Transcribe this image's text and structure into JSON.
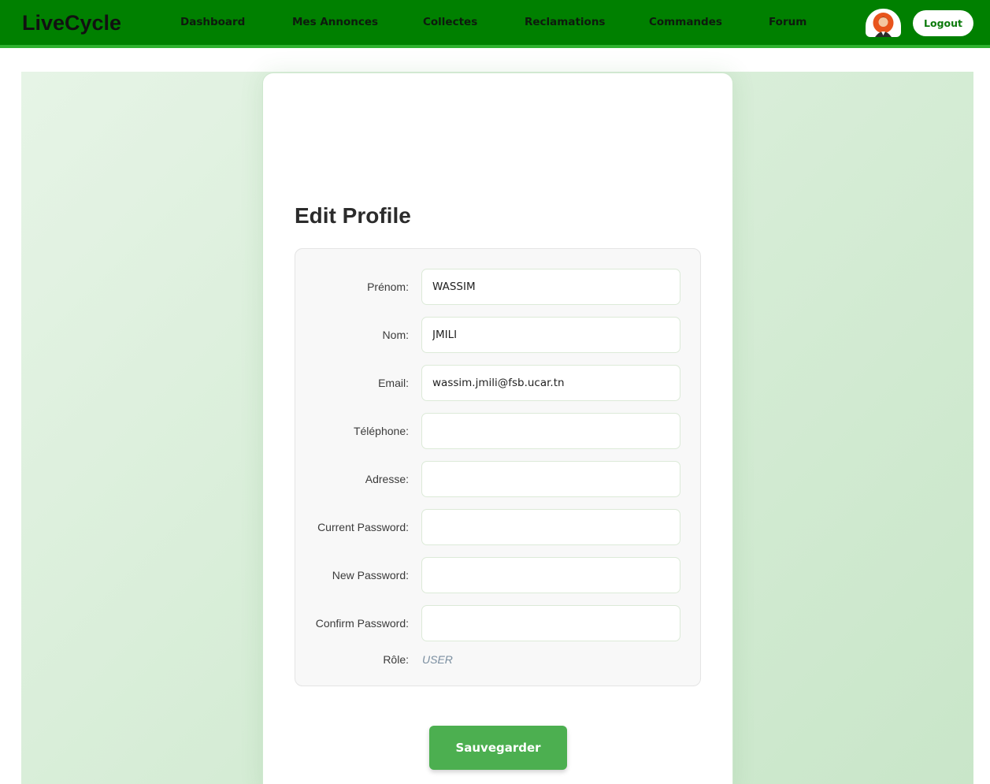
{
  "navbar": {
    "brand": "LiveCycle",
    "links": [
      "Dashboard",
      "Mes Annonces",
      "Collectes",
      "Reclamations",
      "Commandes",
      "Forum"
    ],
    "logout_label": "Logout",
    "accent_color": "#008000"
  },
  "profile": {
    "title": "Edit Profile",
    "fields": [
      {
        "label": "Prénom:",
        "value": "WASSIM"
      },
      {
        "label": "Nom:",
        "value": "JMILI"
      },
      {
        "label": "Email:",
        "value": "wassim.jmili@fsb.ucar.tn"
      },
      {
        "label": "Téléphone:",
        "value": ""
      },
      {
        "label": "Adresse:",
        "value": ""
      },
      {
        "label": "Current Password:",
        "value": ""
      },
      {
        "label": "New Password:",
        "value": ""
      },
      {
        "label": "Confirm Password:",
        "value": ""
      }
    ],
    "role_label": "Rôle:",
    "role_value": "USER",
    "save_label": "Sauvegarder",
    "button_color": "#4caf50"
  }
}
